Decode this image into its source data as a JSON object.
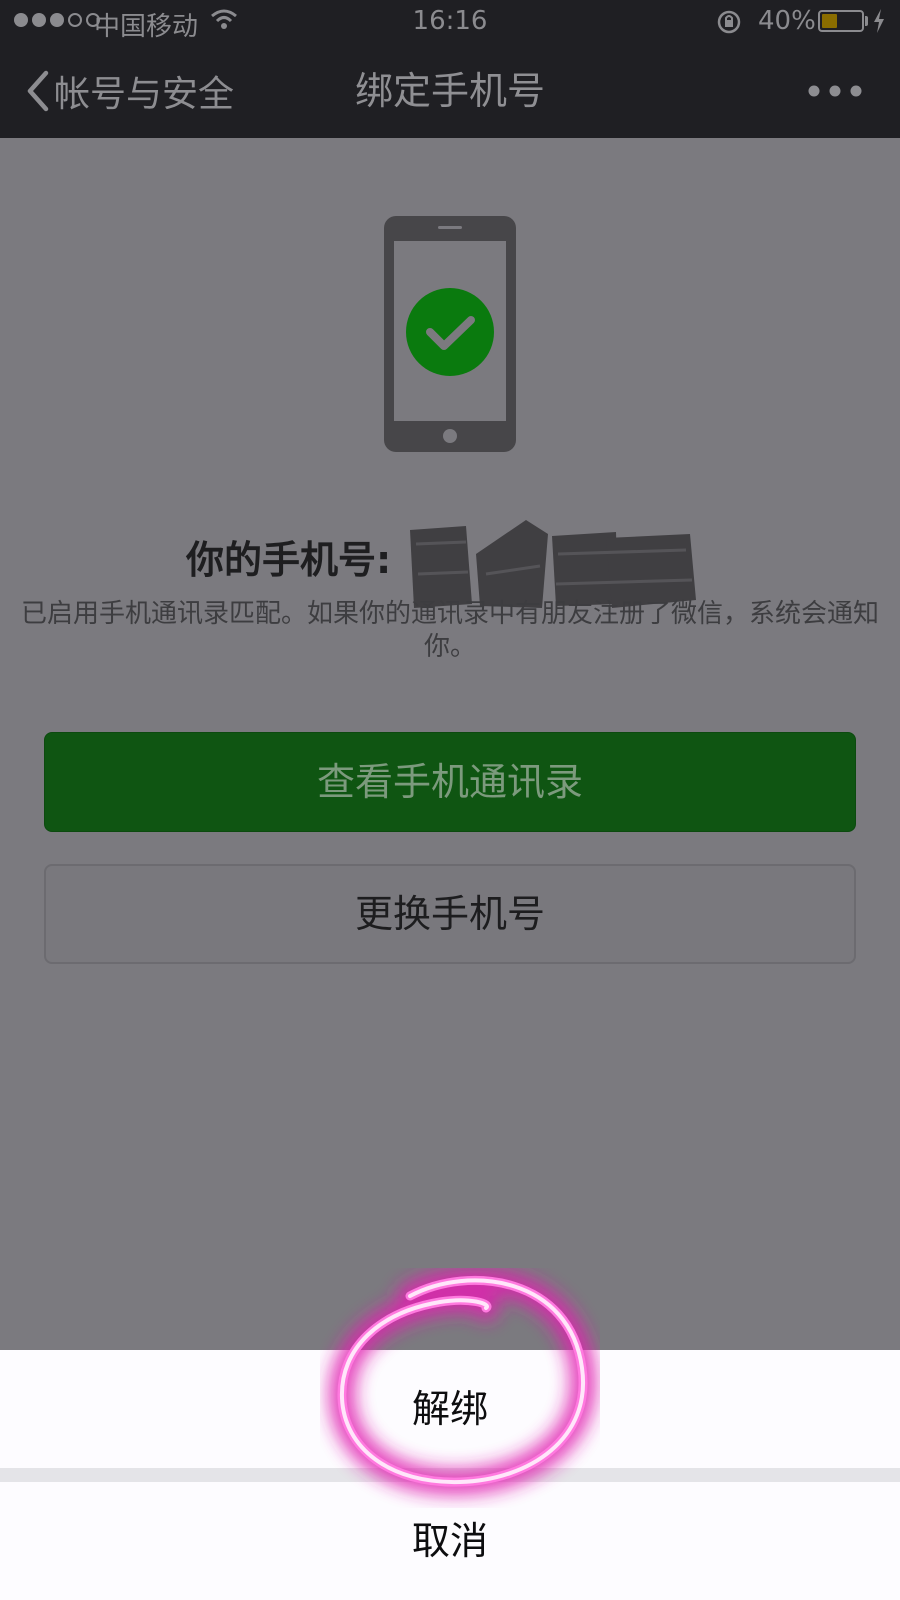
{
  "status_bar": {
    "carrier": "中国移动",
    "time": "16:16",
    "battery_percent": "40%",
    "battery_level": 0.4,
    "signal_bars_filled": 3,
    "signal_bars_total": 5
  },
  "nav": {
    "back_label": "帐号与安全",
    "title": "绑定手机号"
  },
  "main": {
    "phone_label": "你的手机号:",
    "description": "已启用手机通讯录匹配。如果你的通讯录中有朋友注册了微信，系统会通知你。",
    "view_contacts_button": "查看手机通讯录",
    "change_phone_button": "更换手机号"
  },
  "action_sheet": {
    "unbind_label": "解绑",
    "cancel_label": "取消"
  },
  "colors": {
    "accent_green": "#0f5512",
    "check_green": "#0a8a10",
    "highlight_pink": "#e020b0"
  },
  "icons": {
    "back": "chevron-left-icon",
    "more": "more-dots-icon",
    "wifi": "wifi-icon",
    "orientation_lock": "orientation-lock-icon",
    "charging": "charging-bolt-icon",
    "phone_check": "phone-check-icon"
  }
}
